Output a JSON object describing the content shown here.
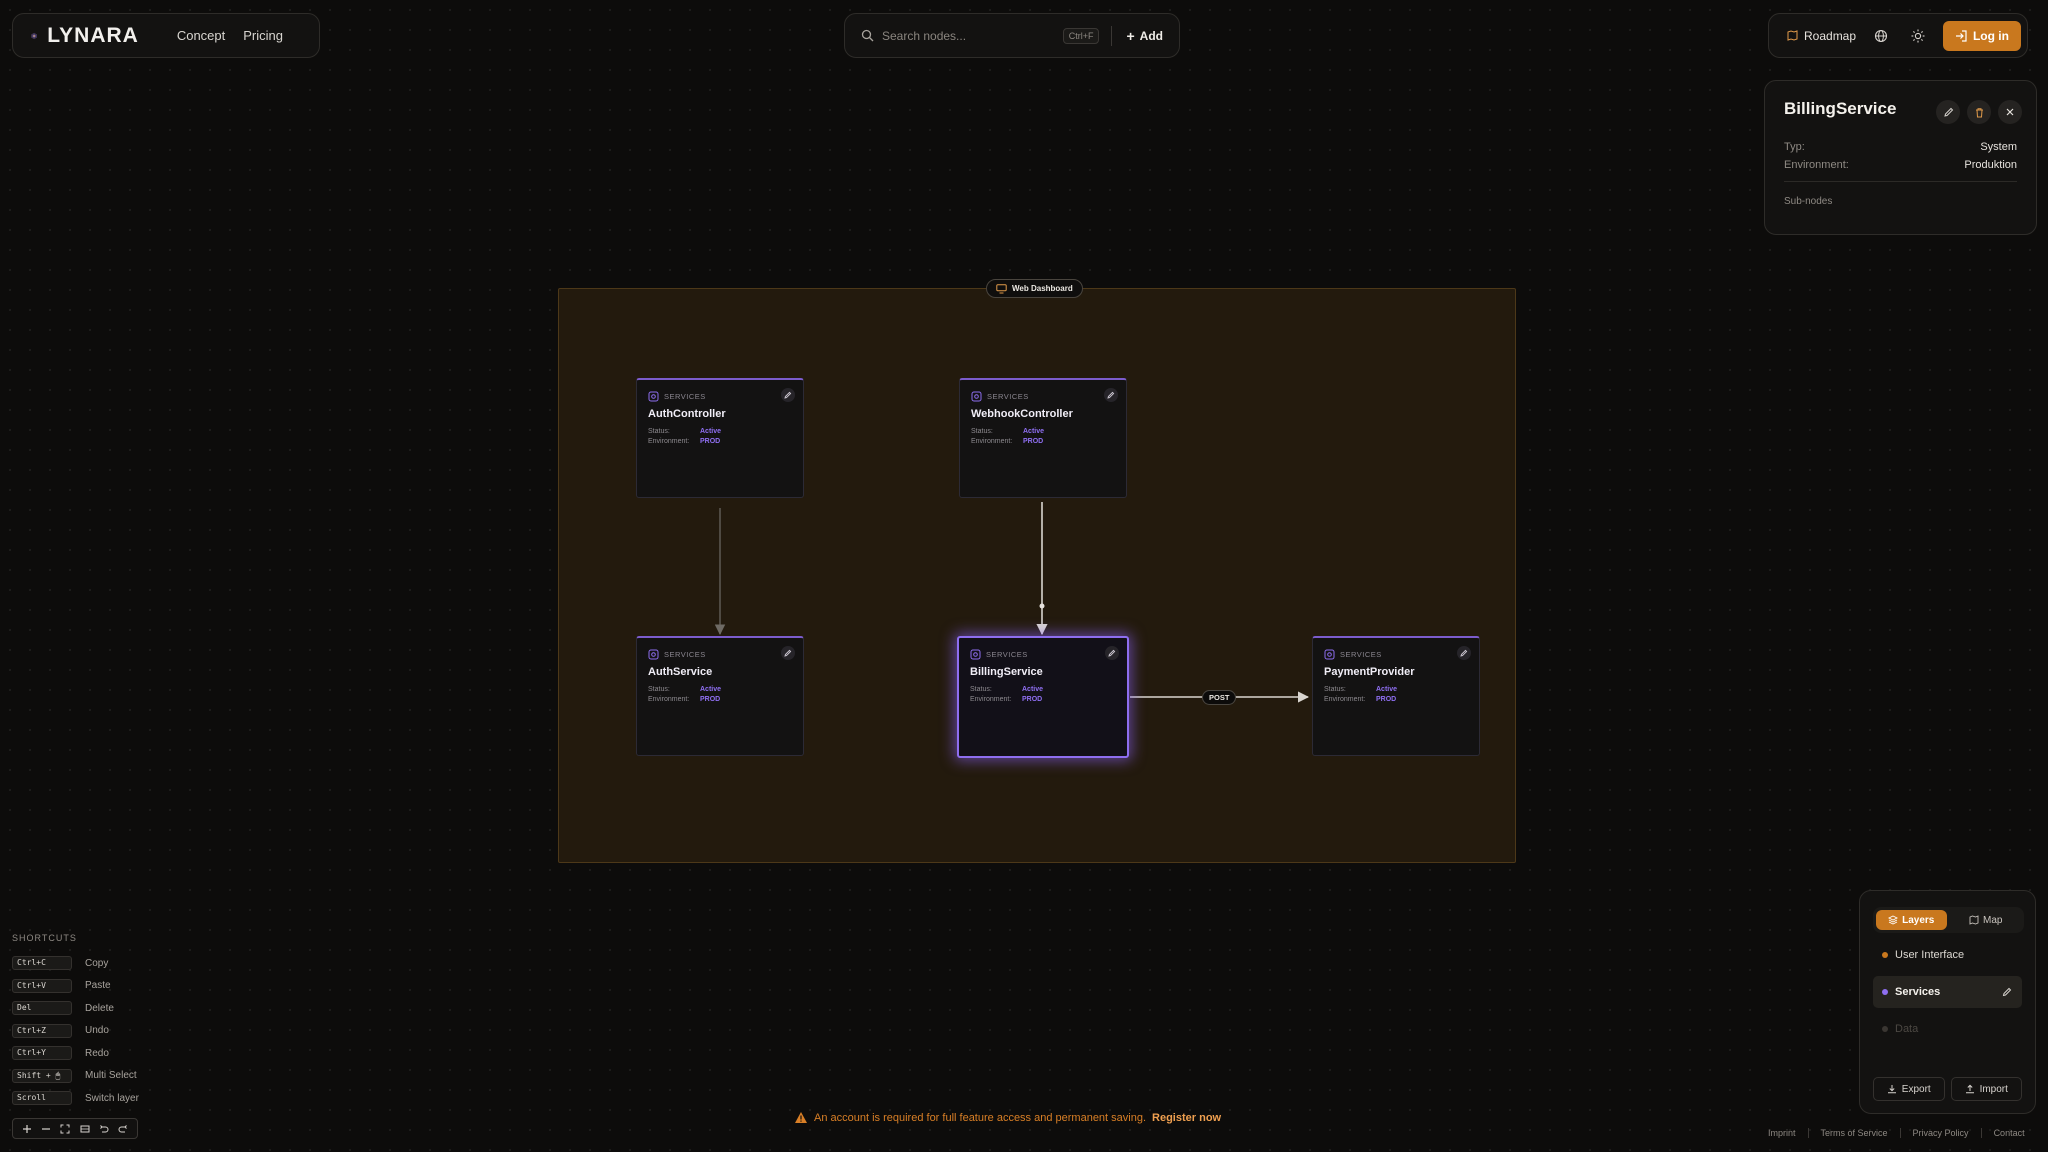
{
  "header": {
    "brand": "LYNARA",
    "nav": [
      {
        "label": "Concept"
      },
      {
        "label": "Pricing"
      }
    ],
    "search": {
      "placeholder": "Search nodes...",
      "shortcut": "Ctrl+F"
    },
    "add_label": "Add",
    "roadmap_label": "Roadmap",
    "login_label": "Log in"
  },
  "details": {
    "title": "BillingService",
    "rows": [
      {
        "key": "Typ:",
        "value": "System"
      },
      {
        "key": "Environment:",
        "value": "Produktion"
      }
    ],
    "subnodes_label": "Sub-nodes"
  },
  "canvas": {
    "group_label": "Web Dashboard",
    "edge_label": "POST",
    "status_key": "Status:",
    "env_key": "Environment:",
    "nodes": [
      {
        "type": "SERVICES",
        "name": "AuthController",
        "status": "Active",
        "env": "PROD"
      },
      {
        "type": "SERVICES",
        "name": "WebhookController",
        "status": "Active",
        "env": "PROD"
      },
      {
        "type": "SERVICES",
        "name": "AuthService",
        "status": "Active",
        "env": "PROD"
      },
      {
        "type": "SERVICES",
        "name": "BillingService",
        "status": "Active",
        "env": "PROD"
      },
      {
        "type": "SERVICES",
        "name": "PaymentProvider",
        "status": "Active",
        "env": "PROD"
      }
    ]
  },
  "shortcuts": {
    "title": "SHORTCUTS",
    "items": [
      {
        "key": "Ctrl+C",
        "label": "Copy"
      },
      {
        "key": "Ctrl+V",
        "label": "Paste"
      },
      {
        "key": "Del",
        "label": "Delete"
      },
      {
        "key": "Ctrl+Z",
        "label": "Undo"
      },
      {
        "key": "Ctrl+Y",
        "label": "Redo"
      },
      {
        "key": "Shift + 🖱",
        "label": "Multi Select"
      },
      {
        "key": "Scroll",
        "label": "Switch layer"
      }
    ]
  },
  "layers": {
    "tabs": [
      {
        "label": "Layers"
      },
      {
        "label": "Map"
      }
    ],
    "items": [
      {
        "label": "User Interface",
        "color": "#c9781e"
      },
      {
        "label": "Services",
        "color": "#8e6ef0"
      },
      {
        "label": "Data",
        "color": "#3a3632"
      }
    ],
    "export_label": "Export",
    "import_label": "Import"
  },
  "footer": {
    "notice": "An account is required for full feature access and permanent saving.",
    "notice_link": "Register now",
    "links": [
      {
        "label": "Imprint"
      },
      {
        "label": "Terms of Service"
      },
      {
        "label": "Privacy Policy"
      },
      {
        "label": "Contact"
      }
    ]
  },
  "colors": {
    "accent": "#c9781e",
    "node_accent": "#8e6ef0",
    "group_fill": "#231a0d"
  }
}
